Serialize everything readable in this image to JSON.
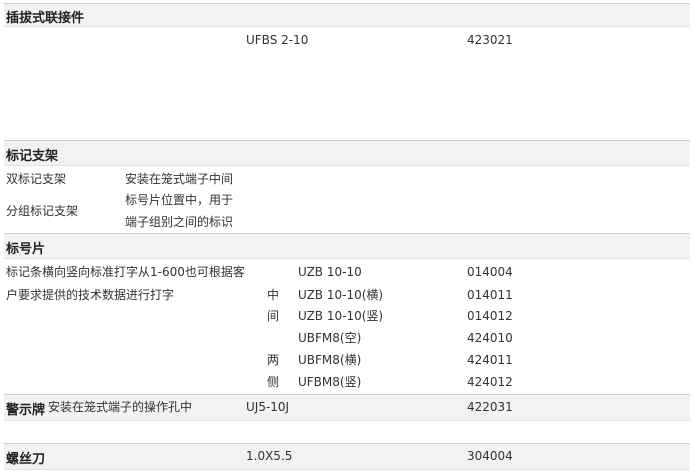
{
  "sections": {
    "plug": {
      "title": "插拔式联接件",
      "model": "UFBS 2-10",
      "code": "423021"
    },
    "marker_bracket": {
      "title": "标记支架",
      "rows": [
        {
          "name": "双标记支架",
          "desc": "安装在笼式端子中间"
        },
        {
          "name": "分组标记支架",
          "desc_line1": "标号片位置中，用于",
          "desc_line2": "端子组别之间的标识"
        }
      ]
    },
    "marker_strip": {
      "title": "标号片",
      "desc_line1": "标记条横向竖向标准打字从1-600也可根据客",
      "desc_line2": "户要求提供的技术数据进行打字",
      "group_middle": [
        "中",
        "间"
      ],
      "group_sides": [
        "两",
        "侧"
      ],
      "items": [
        {
          "model": "UZB 10-10",
          "code": "014004"
        },
        {
          "model": "UZB 10-10(横)",
          "code": "014011"
        },
        {
          "model": "UZB 10-10(竖)",
          "code": "014012"
        },
        {
          "model": "UBFM8(空)",
          "code": "424010"
        },
        {
          "model": "UBFM8(横)",
          "code": "424011"
        },
        {
          "model": "UFBM8(竖)",
          "code": "424012"
        }
      ]
    },
    "warning": {
      "title": "警示牌",
      "desc": "安装在笼式端子的操作孔中",
      "model": "UJ5-10J",
      "code": "422031"
    },
    "screwdriver": {
      "title": "螺丝刀",
      "model": "1.0X5.5",
      "code": "304004"
    }
  }
}
